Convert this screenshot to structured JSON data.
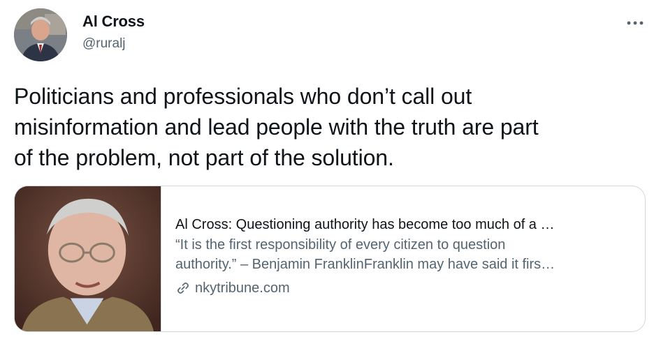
{
  "author": {
    "name": "Al Cross",
    "handle": "@ruralj"
  },
  "icons": {
    "more": "more-horizontal-icon",
    "link": "link-icon"
  },
  "tweet": {
    "text": "Politicians and professionals who don’t call out\nmisinformation and lead people with the truth are part\nof the problem, not part of the solution."
  },
  "card": {
    "title": "Al Cross: Questioning authority has become too much of a …",
    "description_line1": "“It is the first responsibility of every citizen to question",
    "description_line2": "authority.” – Benjamin FranklinFranklin may have said it firs…",
    "domain": "nkytribune.com"
  },
  "colors": {
    "text_primary": "#0f1419",
    "text_secondary": "#536471",
    "border": "#cfd9de"
  }
}
